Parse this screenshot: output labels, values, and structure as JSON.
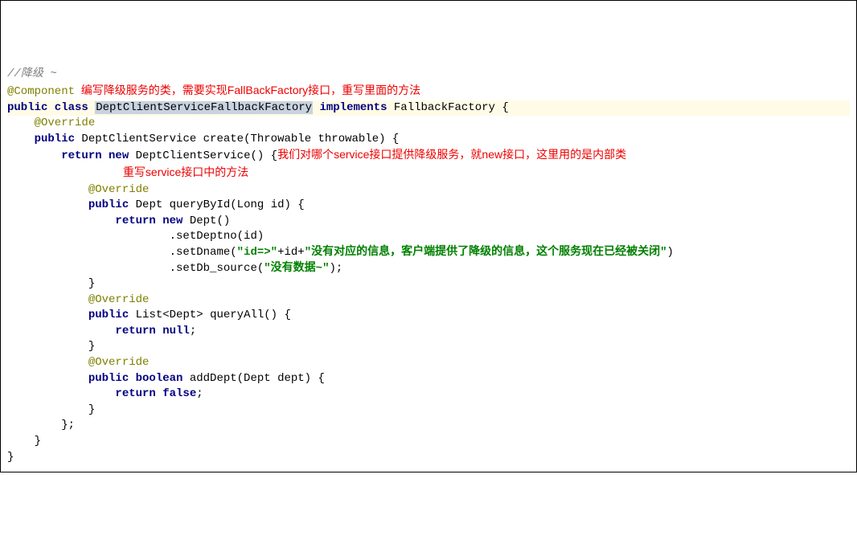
{
  "code": {
    "l01_comment": "//降级 ~",
    "l02_at": "@Component",
    "l02_red": "  编写降级服务的类，需要实现FallBackFactory接口，重写里面的方法",
    "l03_kw1": "public class ",
    "l03_classname": "DeptClientServiceFallbackFactory",
    "l03_kw2": " implements ",
    "l03_type": "FallbackFactory",
    "l03_brace": " {",
    "l04": "    @Override",
    "l05_kw": "    public ",
    "l05_type": "DeptClientService ",
    "l05_method": "create",
    "l05_params": "(Throwable throwable) {",
    "l06_kw": "        return new ",
    "l06_type": "DeptClientService() {",
    "l06_red": "我们对哪个service接口提供降级服务，就new接口，这里用的是内部类",
    "l07_empty": "",
    "l07_red": "                                     重写service接口中的方法",
    "l08": "            @Override",
    "l09_kw": "            public ",
    "l09_type": "Dept ",
    "l09_method": "queryById",
    "l09_params": "(Long id) {",
    "l10_kw": "                return new ",
    "l10_type": "Dept()",
    "l11_method": "                        .setDeptno(id)",
    "l12_method_pre": "                        .setDname(",
    "l12_str1": "\"id=>\"",
    "l12_plus1": "+id+",
    "l12_str2": "\"没有对应的信息，客户端提供了降级的信息，这个服务现在已经被关闭\"",
    "l12_close": ")",
    "l13_method_pre": "                        .setDb_source(",
    "l13_str": "\"没有数据~\"",
    "l13_close": ");",
    "l14": "            }",
    "l15": "",
    "l16": "            @Override",
    "l17_kw": "            public ",
    "l17_type": "List<Dept> ",
    "l17_method": "queryAll",
    "l17_params": "() {",
    "l18_kw": "                return null",
    "l18_semi": ";",
    "l19": "            }",
    "l20": "",
    "l21": "            @Override",
    "l22_kw": "            public boolean ",
    "l22_method": "addDept",
    "l22_params": "(Dept dept) {",
    "l23_kw": "                return false",
    "l23_semi": ";",
    "l24": "            }",
    "l25": "        };",
    "l26": "    }",
    "l27": "}"
  }
}
